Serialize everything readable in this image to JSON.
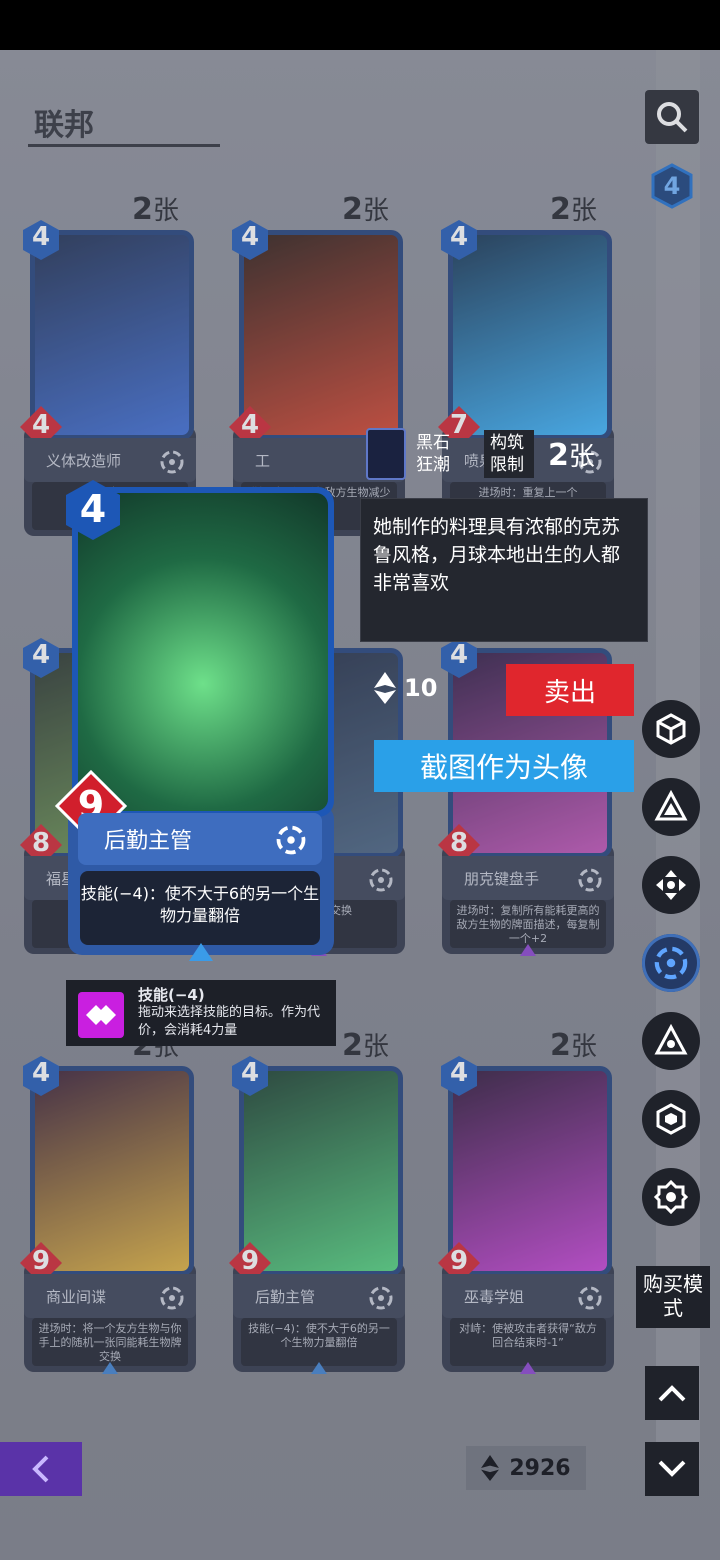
{
  "header": {
    "title": "联邦",
    "page_number": "4"
  },
  "cards_row1": [
    {
      "count": "2",
      "unit": "张",
      "cost": "4",
      "power": "4",
      "name": "义体改造师",
      "desc": "进场时：...",
      "colors": [
        "#1b2b4e",
        "#3a6bd6"
      ]
    },
    {
      "count": "2",
      "unit": "张",
      "cost": "4",
      "power": "4",
      "name": "工",
      "desc": "进场时：使所有敌方生物减少",
      "colors": [
        "#2b1a14",
        "#d4412b"
      ]
    },
    {
      "count": "2",
      "unit": "张",
      "cost": "4",
      "power": "7",
      "name": "喷泉侠",
      "desc": "进场时：重复上一个",
      "colors": [
        "#12304e",
        "#39b5ff"
      ]
    }
  ],
  "cards_row2": [
    {
      "cost": "4",
      "power": "8",
      "name": "福星",
      "desc": "进",
      "colors": [
        "#25302a",
        "#6f9b52"
      ]
    },
    {
      "cost": "",
      "power": "",
      "name": "",
      "desc": "边的一个交换",
      "colors": [
        "#1c2740",
        "#45607f"
      ]
    },
    {
      "cost": "4",
      "power": "8",
      "name": "朋克键盘手",
      "desc": "进场时：复制所有能耗更高的敌方生物的牌面描述，每复制一个+2",
      "colors": [
        "#2c1740",
        "#c04fb7"
      ]
    }
  ],
  "cards_row3": [
    {
      "count": "2",
      "unit": "张",
      "cost": "4",
      "power": "9",
      "name": "商业间谍",
      "desc": "进场时：将一个友方生物与你手上的随机一张同能耗生物牌交换",
      "colors": [
        "#361a32",
        "#e0b13a"
      ]
    },
    {
      "count": "2",
      "unit": "张",
      "cost": "4",
      "power": "9",
      "name": "后勤主管",
      "desc": "技能(−4)：使不大于6的另一个生物力量翻倍",
      "colors": [
        "#163a2a",
        "#4fd27c"
      ]
    },
    {
      "count": "2",
      "unit": "张",
      "cost": "4",
      "power": "9",
      "name": "巫毒学姐",
      "desc": "对峙：使被攻击者获得“敌方回合结束时-1”",
      "colors": [
        "#2b1436",
        "#c63fd6"
      ]
    }
  ],
  "selected_card": {
    "cost": "4",
    "power": "9",
    "name": "后勤主管",
    "desc": "技能(−4)：使不大于6的另一个生物力量翻倍"
  },
  "mid_info": {
    "card_label": "黑石狂潮",
    "restriction": "构筑限制",
    "count": "2",
    "unit": "张"
  },
  "lore_tooltip": "她制作的料理具有浓郁的克苏鲁风格，月球本地出生的人都非常喜欢",
  "skill_tooltip": {
    "title": "技能(−4)",
    "text": "拖动来选择技能的目标。作为代价，会消耗4力量"
  },
  "energy_cost": "10",
  "actions": {
    "sell": "卖出",
    "avatar": "截图作为头像",
    "buy_mode": "购买模式"
  },
  "currency": "2926",
  "colors": {
    "accent_blue": "#2aa0e8",
    "sell_red": "#e0262d",
    "power_red": "#d11f2c",
    "cost_blue": "#1d57b6",
    "faction_purple": "#5a33a8"
  }
}
